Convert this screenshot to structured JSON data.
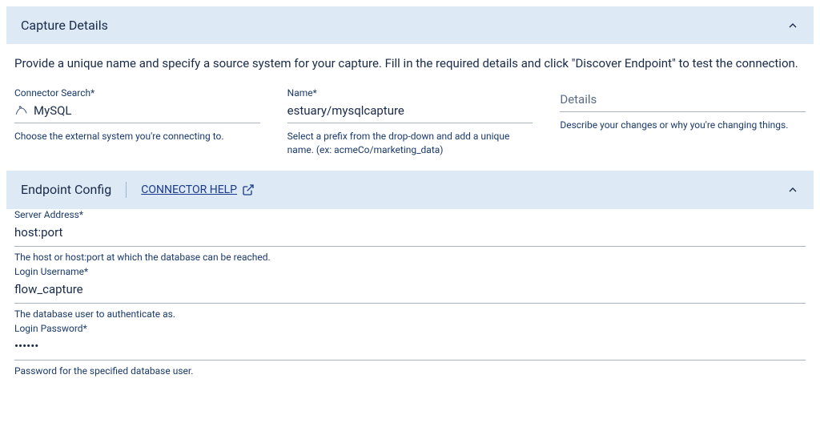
{
  "captureDetails": {
    "title": "Capture Details",
    "intro": "Provide a unique name and specify a source system for your capture. Fill in the required details and click \"Discover Endpoint\" to test the connection.",
    "fields": {
      "connector": {
        "label": "Connector Search*",
        "value": "MySQL",
        "help": "Choose the external system you're connecting to."
      },
      "name": {
        "label": "Name*",
        "value": "estuary/mysqlcapture",
        "help": "Select a prefix from the drop-down and add a unique name. (ex: acmeCo/marketing_data)"
      },
      "details": {
        "label": "",
        "placeholder": "Details",
        "help": "Describe your changes or why you're changing things."
      }
    }
  },
  "endpointConfig": {
    "title": "Endpoint Config",
    "helpLink": "CONNECTOR HELP",
    "fields": {
      "serverAddress": {
        "label": "Server Address*",
        "value": "host:port",
        "help": "The host or host:port at which the database can be reached."
      },
      "loginUsername": {
        "label": "Login Username*",
        "value": "flow_capture",
        "help": "The database user to authenticate as."
      },
      "loginPassword": {
        "label": "Login Password*",
        "value": "••••••",
        "help": "Password for the specified database user."
      }
    }
  }
}
